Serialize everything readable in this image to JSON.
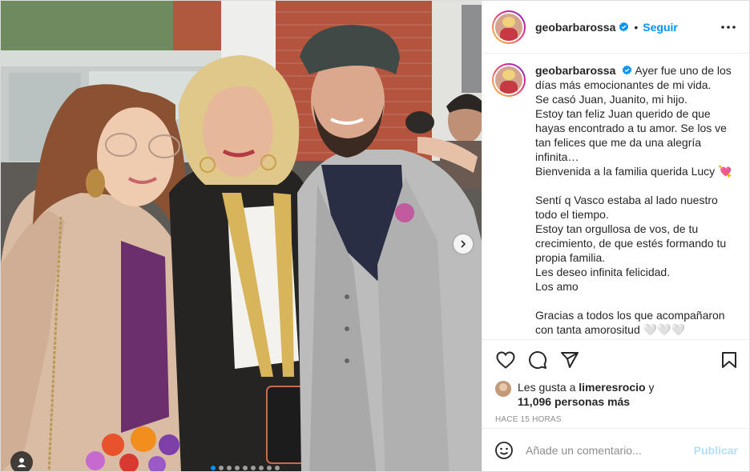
{
  "post": {
    "username": "geobarbarossa",
    "separator": "•",
    "follow_label": "Seguir",
    "more_icon": "more-options-icon",
    "verified_color": "#0095f6"
  },
  "caption": {
    "username": "geobarbarossa",
    "lines": [
      "Ayer fue uno de los días más emocionantes de mi vida.",
      "Se casó Juan, Juanito, mi hijo.",
      "Estoy tan feliz Juan querido de que hayas encontrado a tu amor. Se los ve tan felices que me da una alegría infinita…",
      "Bienvenida a la familia querida Lucy 💘",
      "",
      "Sentí q Vasco estaba al lado nuestro todo el tiempo.",
      "Estoy tan orgullosa de vos, de tu crecimiento, de que estés formando tu propia familia.",
      "Les deseo infinita felicidad.",
      "Los amo",
      "",
      "Gracias a todos los que acompañaron con tanta amorositud 🤍🤍🤍"
    ]
  },
  "actions": {
    "icons": [
      "heart-icon",
      "comment-icon",
      "share-icon",
      "save-icon"
    ]
  },
  "likes": {
    "prefix": "Les gusta a",
    "user": "limeresrocio",
    "connector": "y",
    "count_text": "11,096 personas más"
  },
  "timestamp": "HACE 15 HORAS",
  "comment": {
    "placeholder": "Añade un comentario...",
    "publish_label": "Publicar",
    "publish_color": "#b2dffc"
  },
  "carousel": {
    "total_slides": 9,
    "active_index": 0
  },
  "colors": {
    "accent": "#0095f6",
    "text": "#262626",
    "muted": "#8e8e8e"
  }
}
